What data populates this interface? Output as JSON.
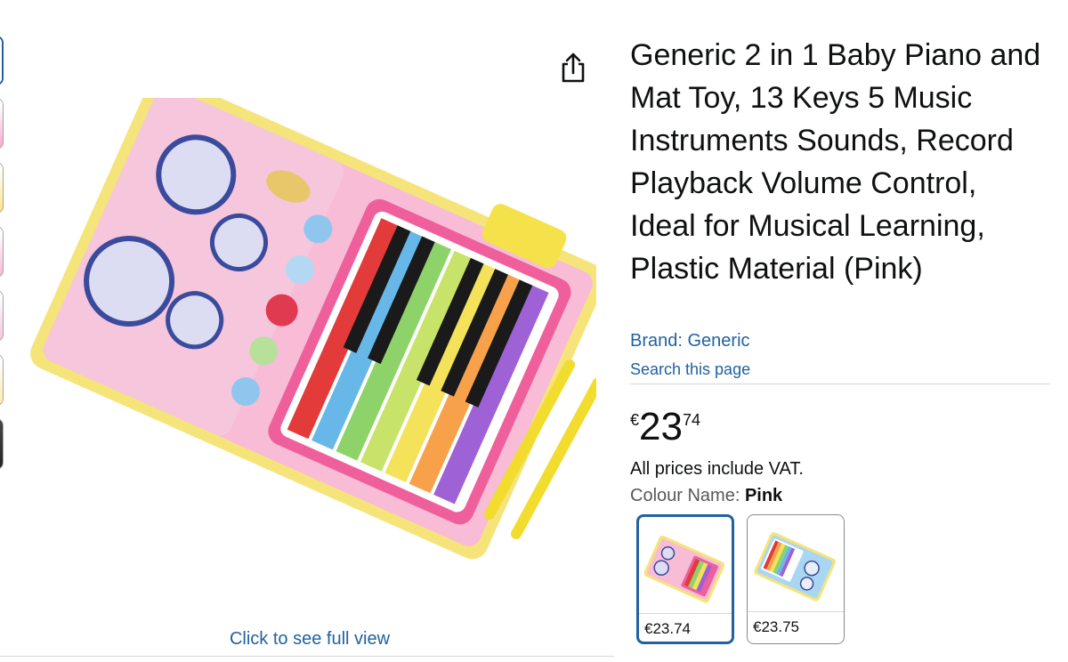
{
  "product": {
    "title": "Generic 2 in 1 Baby Piano and Mat Toy, 13 Keys 5 Music Instruments Sounds, Record Playback Volume Control, Ideal for Musical Learning, Plastic Material (Pink)",
    "brand_link": "Brand: Generic",
    "search_page": "Search this page",
    "price": {
      "symbol": "€",
      "whole": "23",
      "fraction": "74"
    },
    "vat_note": "All prices include VAT.",
    "colour_label": "Colour Name: ",
    "colour_value": "Pink"
  },
  "gallery": {
    "see_full_view": "Click to see full view",
    "share_icon": "share-icon",
    "thumbnail_count": 7
  },
  "variants": [
    {
      "name": "Pink",
      "price": "€23.74",
      "selected": true
    },
    {
      "name": "Blue",
      "price": "€23.75",
      "selected": false
    }
  ],
  "colors": {
    "link": "#2162a1",
    "selected_border": "#2162a1",
    "text": "#0f1111"
  }
}
